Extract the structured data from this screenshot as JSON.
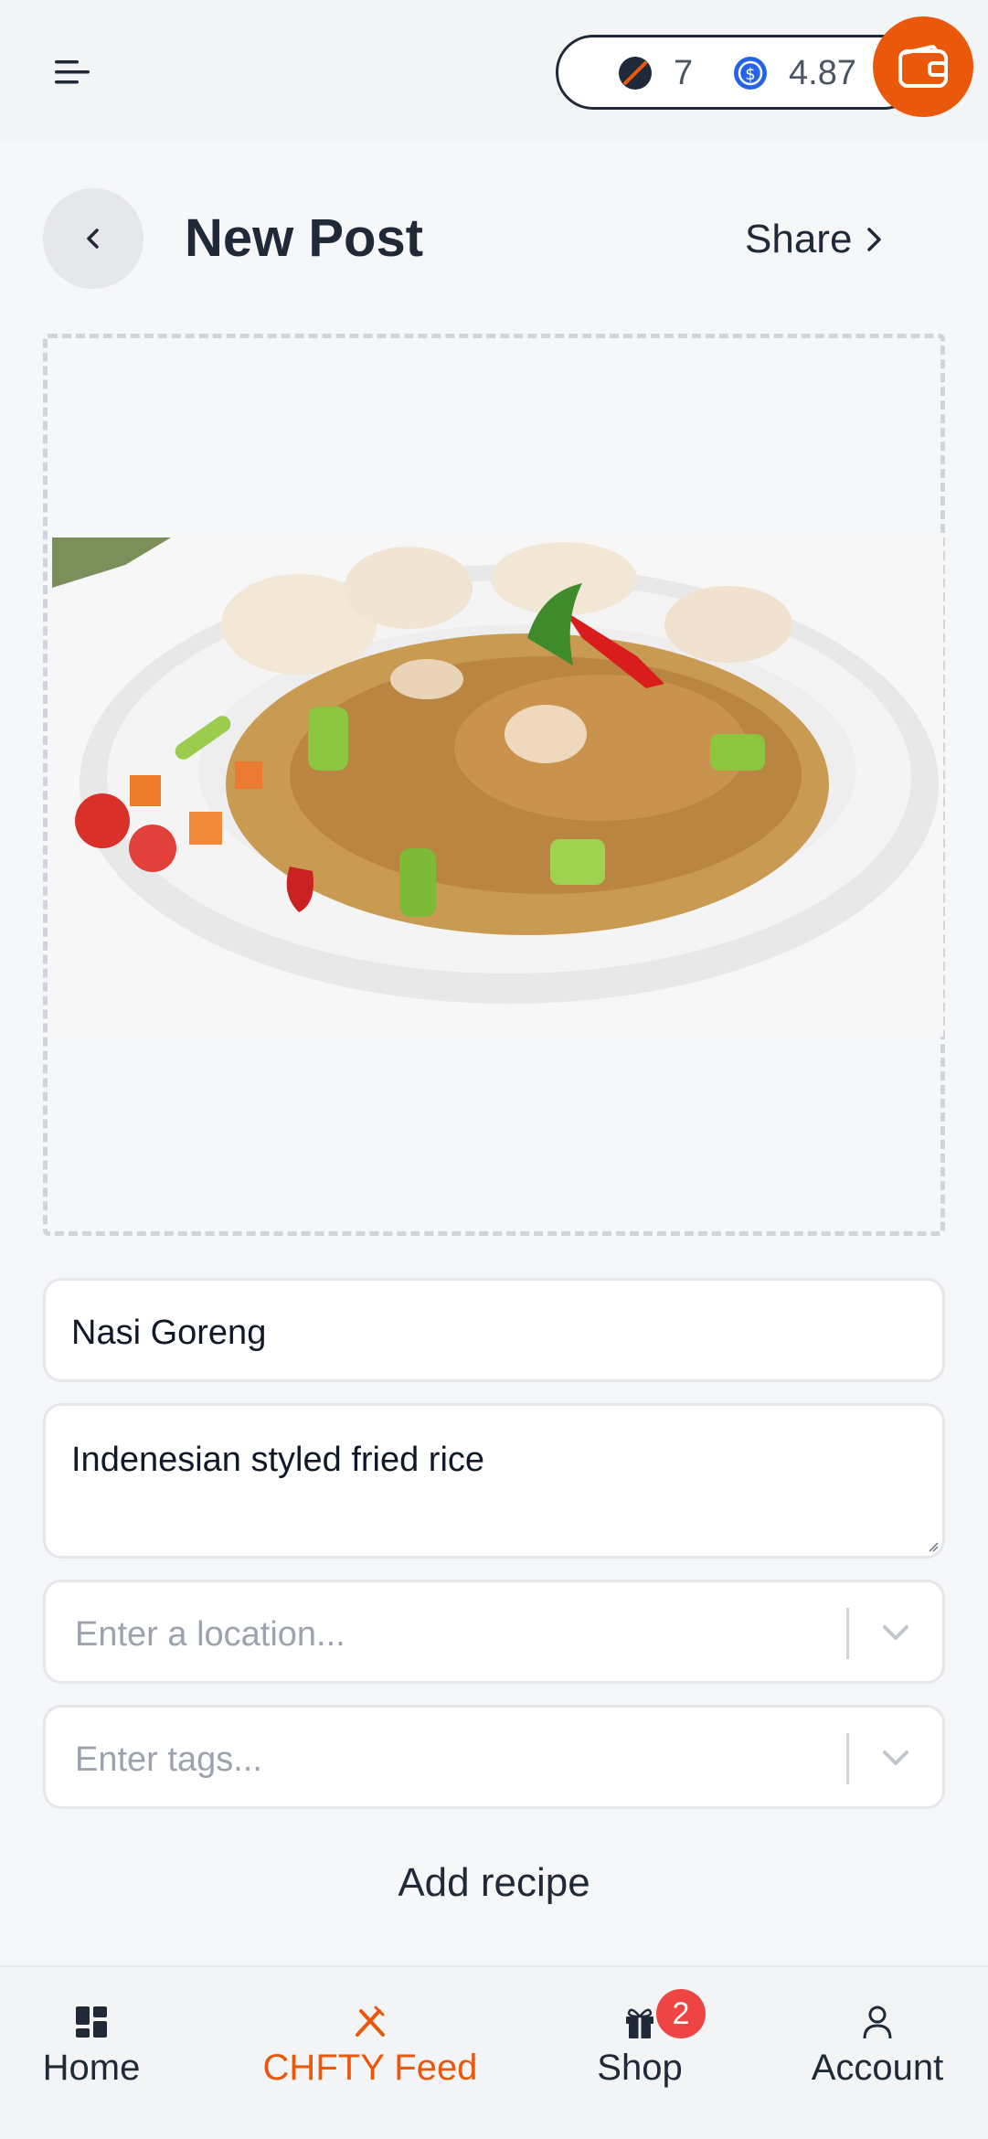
{
  "topbar": {
    "points": "7",
    "coins": "4.87",
    "menu_icon": "menu-icon",
    "wallet_icon": "wallet-icon"
  },
  "header": {
    "title": "New Post",
    "share_label": "Share"
  },
  "form": {
    "title_value": "Nasi Goreng",
    "description_value": "Indenesian styled fried rice",
    "location_placeholder": "Enter a location...",
    "tags_placeholder": "Enter tags...",
    "add_recipe_label": "Add recipe"
  },
  "bottom_nav": {
    "items": [
      {
        "label": "Home",
        "icon": "grid-icon"
      },
      {
        "label": "CHFTY Feed",
        "icon": "fork-knife-icon",
        "active": true
      },
      {
        "label": "Shop",
        "icon": "gift-icon",
        "badge": "2"
      },
      {
        "label": "Account",
        "icon": "user-icon"
      }
    ]
  },
  "colors": {
    "accent": "#ea580c",
    "badge": "#ef4444",
    "coin_blue": "#2563eb"
  }
}
